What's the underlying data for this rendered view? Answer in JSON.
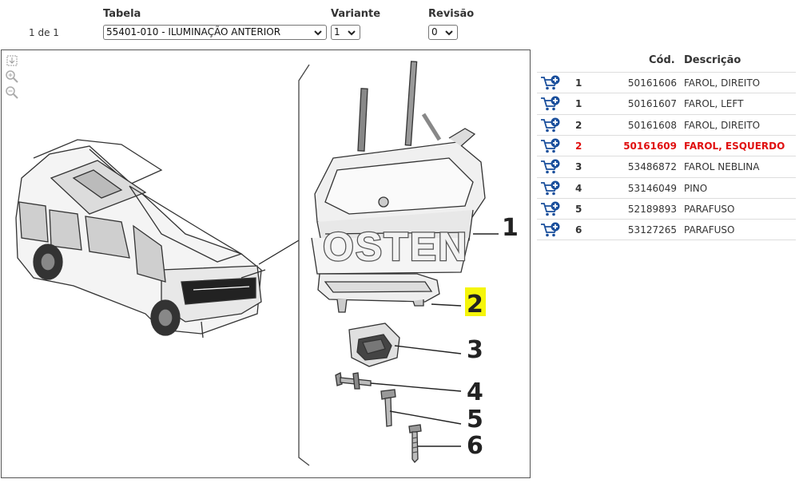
{
  "header": {
    "page_indicator": "1 de 1",
    "tabela_label": "Tabela",
    "tabela_value": "55401-010 - ILUMINAÇÃO ANTERIOR",
    "variante_label": "Variante",
    "variante_value": "1",
    "revisao_label": "Revisão",
    "revisao_value": "0"
  },
  "diagram": {
    "watermark": "OSTEN",
    "callouts": [
      "1",
      "2",
      "3",
      "4",
      "5",
      "6"
    ],
    "selected_callout": "2",
    "highlight_color": "#f5f50a"
  },
  "parts_table": {
    "col_code": "Cód.",
    "col_desc": "Descrição",
    "rows": [
      {
        "pos": "1",
        "code": "50161606",
        "desc": "FAROL, DIREITO"
      },
      {
        "pos": "1",
        "code": "50161607",
        "desc": "FAROL, LEFT"
      },
      {
        "pos": "2",
        "code": "50161608",
        "desc": "FAROL, DIREITO"
      },
      {
        "pos": "2",
        "code": "50161609",
        "desc": "FAROL, ESQUERDO"
      },
      {
        "pos": "3",
        "code": "53486872",
        "desc": "FAROL NEBLINA"
      },
      {
        "pos": "4",
        "code": "53146049",
        "desc": "PINO"
      },
      {
        "pos": "5",
        "code": "52189893",
        "desc": "PARAFUSO"
      },
      {
        "pos": "6",
        "code": "53127265",
        "desc": "PARAFUSO"
      }
    ],
    "selected_color": "#e01010",
    "cart_icon": "add-to-cart-icon"
  }
}
